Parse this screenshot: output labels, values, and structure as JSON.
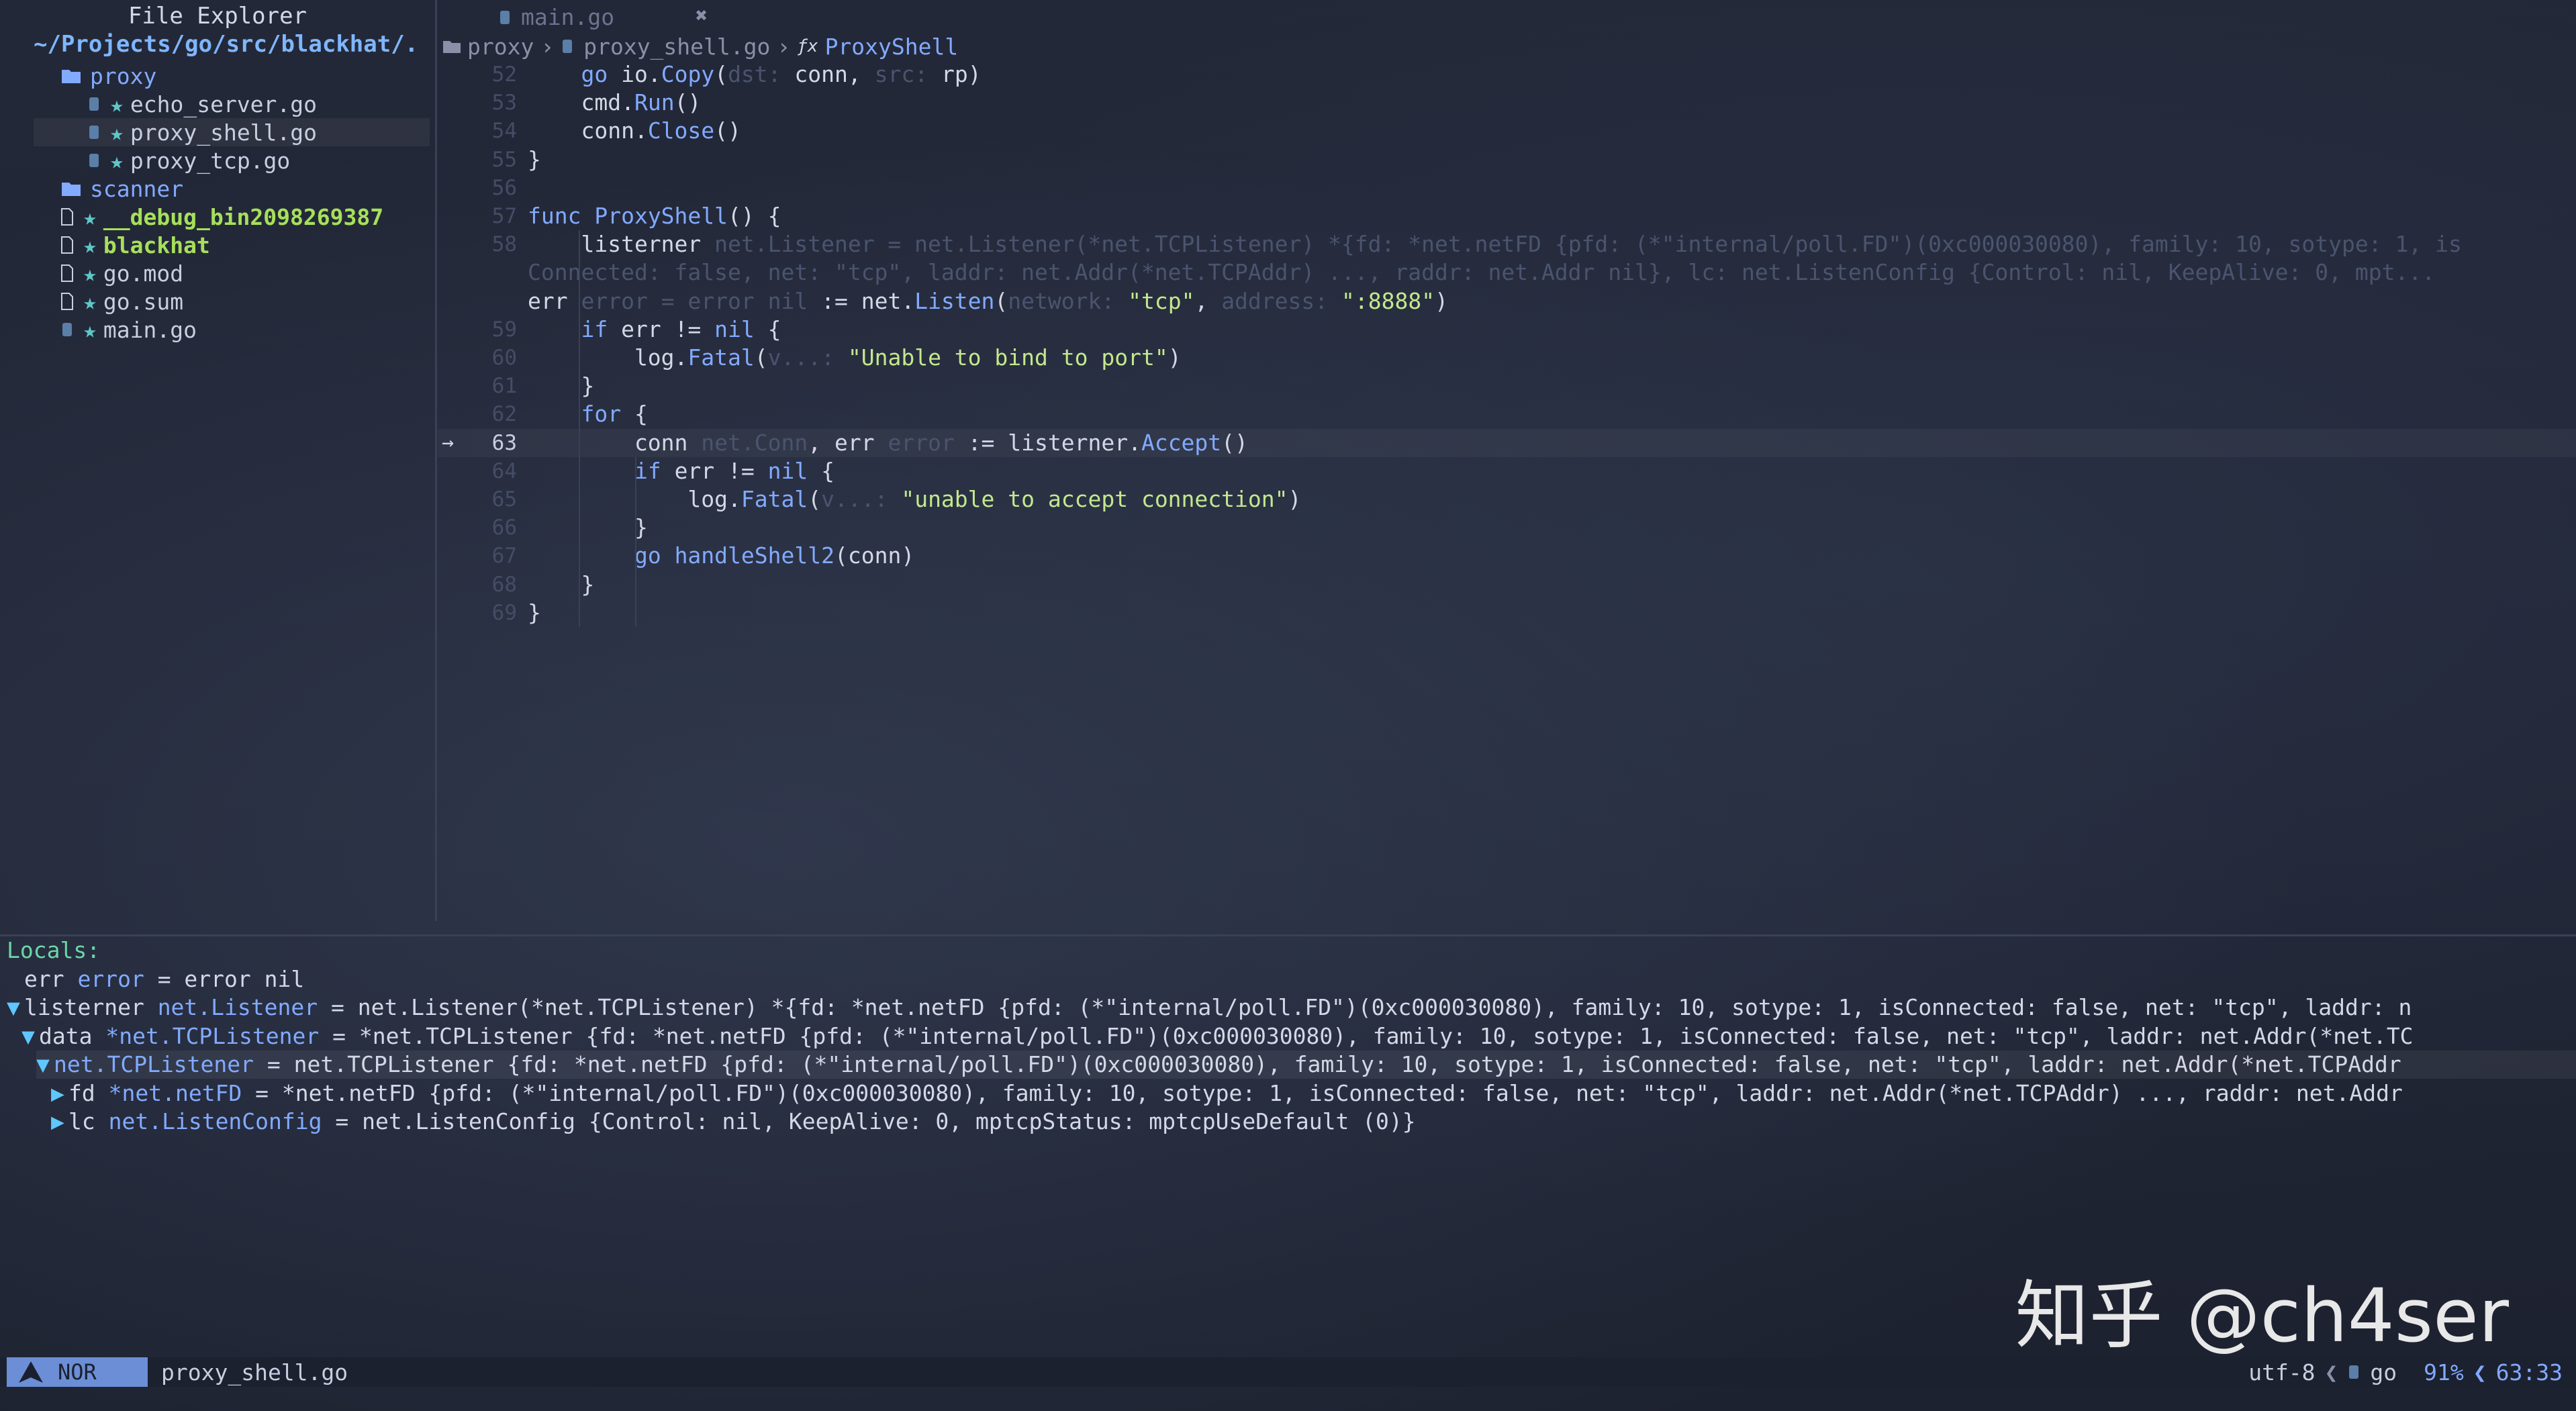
{
  "explorer": {
    "title": "File Explorer",
    "cwd": "~/Projects/go/src/blackhat/.",
    "items": [
      {
        "name": "proxy",
        "kind": "dir",
        "open": true
      },
      {
        "name": "echo_server.go",
        "kind": "go"
      },
      {
        "name": "proxy_shell.go",
        "kind": "go",
        "selected": true
      },
      {
        "name": "proxy_tcp.go",
        "kind": "go"
      },
      {
        "name": "scanner",
        "kind": "dir"
      },
      {
        "name": "__debug_bin2098269387",
        "kind": "bin"
      },
      {
        "name": "blackhat",
        "kind": "bin"
      },
      {
        "name": "go.mod",
        "kind": "file"
      },
      {
        "name": "go.sum",
        "kind": "file"
      },
      {
        "name": "main.go",
        "kind": "go"
      }
    ]
  },
  "tabs": {
    "items": [
      {
        "label": "main.go"
      }
    ],
    "close_glyph": "✖"
  },
  "breadcrumb": {
    "dir": "proxy",
    "sep": "›",
    "file": "proxy_shell.go",
    "fx": "ƒx",
    "func": "ProxyShell"
  },
  "editor": {
    "lines": [
      {
        "n": "52",
        "segs": [
          [
            "plain",
            "    "
          ],
          [
            "kw",
            "go "
          ],
          [
            "plain",
            "io."
          ],
          [
            "fn",
            "Copy"
          ],
          [
            "plain",
            "("
          ],
          [
            "hint",
            "dst: "
          ],
          [
            "plain",
            "conn, "
          ],
          [
            "hint",
            "src: "
          ],
          [
            "plain",
            "rp)"
          ]
        ]
      },
      {
        "n": "53",
        "segs": [
          [
            "plain",
            "    cmd."
          ],
          [
            "fn",
            "Run"
          ],
          [
            "plain",
            "()"
          ]
        ]
      },
      {
        "n": "54",
        "segs": [
          [
            "plain",
            "    conn."
          ],
          [
            "fn",
            "Close"
          ],
          [
            "plain",
            "()"
          ]
        ]
      },
      {
        "n": "55",
        "segs": [
          [
            "plain",
            "}"
          ]
        ]
      },
      {
        "n": "56",
        "segs": [
          [
            "plain",
            ""
          ]
        ]
      },
      {
        "n": "57",
        "segs": [
          [
            "kw",
            "func "
          ],
          [
            "fn",
            "ProxyShell"
          ],
          [
            "plain",
            "() {"
          ]
        ]
      },
      {
        "n": "58",
        "segs": [
          [
            "plain",
            "    listerner "
          ],
          [
            "ty",
            "net.Listener = net.Listener(*net.TCPListener) *{fd: *net.netFD {pfd: (*\"internal/poll.FD\")(0xc000030080), family: 10, sotype: 1, is"
          ]
        ]
      },
      {
        "n": "",
        "segs": [
          [
            "ty",
            "Connected: false, net: \"tcp\", laddr: net.Addr(*net.TCPAddr) ..., raddr: net.Addr nil}, lc: net.ListenConfig {Control: nil, KeepAlive: 0, mpt..."
          ]
        ]
      },
      {
        "n": "",
        "segs": [
          [
            "plain",
            "err "
          ],
          [
            "ty",
            "error = error nil "
          ],
          [
            "plain",
            ":= net."
          ],
          [
            "fn",
            "Listen"
          ],
          [
            "plain",
            "("
          ],
          [
            "hint",
            "network: "
          ],
          [
            "str",
            "\"tcp\""
          ],
          [
            "plain",
            ", "
          ],
          [
            "hint",
            "address: "
          ],
          [
            "str",
            "\":8888\""
          ],
          [
            "plain",
            ")"
          ]
        ]
      },
      {
        "n": "59",
        "segs": [
          [
            "plain",
            "    "
          ],
          [
            "kw",
            "if "
          ],
          [
            "plain",
            "err != "
          ],
          [
            "kw",
            "nil "
          ],
          [
            "plain",
            "{"
          ]
        ]
      },
      {
        "n": "60",
        "segs": [
          [
            "plain",
            "        log."
          ],
          [
            "fn",
            "Fatal"
          ],
          [
            "plain",
            "("
          ],
          [
            "hint",
            "v...: "
          ],
          [
            "str",
            "\"Unable to bind to port\""
          ],
          [
            "plain",
            ")"
          ]
        ]
      },
      {
        "n": "61",
        "segs": [
          [
            "plain",
            "    }"
          ]
        ]
      },
      {
        "n": "62",
        "segs": [
          [
            "plain",
            "    "
          ],
          [
            "kw",
            "for "
          ],
          [
            "plain",
            "{"
          ]
        ]
      },
      {
        "n": "63",
        "cur": true,
        "segs": [
          [
            "plain",
            "        conn "
          ],
          [
            "ty",
            "net.Conn"
          ],
          [
            "plain",
            ", err "
          ],
          [
            "ty",
            "error"
          ],
          [
            "plain",
            " := listerner."
          ],
          [
            "fn",
            "Accept"
          ],
          [
            "plain",
            "()"
          ]
        ]
      },
      {
        "n": "64",
        "segs": [
          [
            "plain",
            "        "
          ],
          [
            "kw",
            "if "
          ],
          [
            "plain",
            "err != "
          ],
          [
            "kw",
            "nil "
          ],
          [
            "plain",
            "{"
          ]
        ]
      },
      {
        "n": "65",
        "segs": [
          [
            "plain",
            "            log."
          ],
          [
            "fn",
            "Fatal"
          ],
          [
            "plain",
            "("
          ],
          [
            "hint",
            "v...: "
          ],
          [
            "str",
            "\"unable to accept connection\""
          ],
          [
            "plain",
            ")"
          ]
        ]
      },
      {
        "n": "66",
        "segs": [
          [
            "plain",
            "        }"
          ]
        ]
      },
      {
        "n": "67",
        "segs": [
          [
            "plain",
            "        "
          ],
          [
            "kw",
            "go "
          ],
          [
            "fn",
            "handleShell2"
          ],
          [
            "plain",
            "(conn)"
          ]
        ]
      },
      {
        "n": "68",
        "segs": [
          [
            "plain",
            "    }"
          ]
        ]
      },
      {
        "n": "69",
        "segs": [
          [
            "plain",
            "}"
          ]
        ]
      }
    ],
    "cursor_arrow": "→"
  },
  "locals": {
    "title": "Locals:",
    "rows": [
      {
        "indent": 0,
        "tri": "",
        "name": "err",
        "type": "error",
        "value": " = error nil"
      },
      {
        "indent": 0,
        "tri": "▼",
        "name": "listerner",
        "type": "net.Listener",
        "value": " = net.Listener(*net.TCPListener) *{fd: *net.netFD {pfd: (*\"internal/poll.FD\")(0xc000030080), family: 10, sotype: 1, isConnected: false, net: \"tcp\", laddr: n"
      },
      {
        "indent": 1,
        "tri": "▼",
        "name": "data",
        "type": "*net.TCPListener",
        "value": " = *net.TCPListener {fd: *net.netFD {pfd: (*\"internal/poll.FD\")(0xc000030080), family: 10, sotype: 1, isConnected: false, net: \"tcp\", laddr: net.Addr(*net.TC"
      },
      {
        "indent": 2,
        "tri": "▼",
        "name": "net.TCPListener",
        "type": "",
        "value": " = net.TCPListener {fd: *net.netFD {pfd: (*\"internal/poll.FD\")(0xc000030080), family: 10, sotype: 1, isConnected: false, net: \"tcp\", laddr: net.Addr(*net.TCPAddr",
        "selected": true
      },
      {
        "indent": 3,
        "tri": "▶",
        "name": "fd",
        "type": "*net.netFD",
        "value": " = *net.netFD {pfd: (*\"internal/poll.FD\")(0xc000030080), family: 10, sotype: 1, isConnected: false, net: \"tcp\", laddr: net.Addr(*net.TCPAddr) ..., raddr: net.Addr"
      },
      {
        "indent": 3,
        "tri": "▶",
        "name": "lc",
        "type": "net.ListenConfig",
        "value": " = net.ListenConfig {Control: nil, KeepAlive: 0, mptcpStatus: mptcpUseDefault (0)}"
      }
    ]
  },
  "status": {
    "mode": "NOR",
    "file": "proxy_shell.go",
    "encoding": "utf-8",
    "filetype": "go",
    "percent": "91%",
    "position": "63:33"
  },
  "watermark": "知乎 @ch4ser",
  "colors": {
    "accent": "#82aaff",
    "string": "#c3e88d",
    "mode_bg": "#6c8ed6"
  }
}
